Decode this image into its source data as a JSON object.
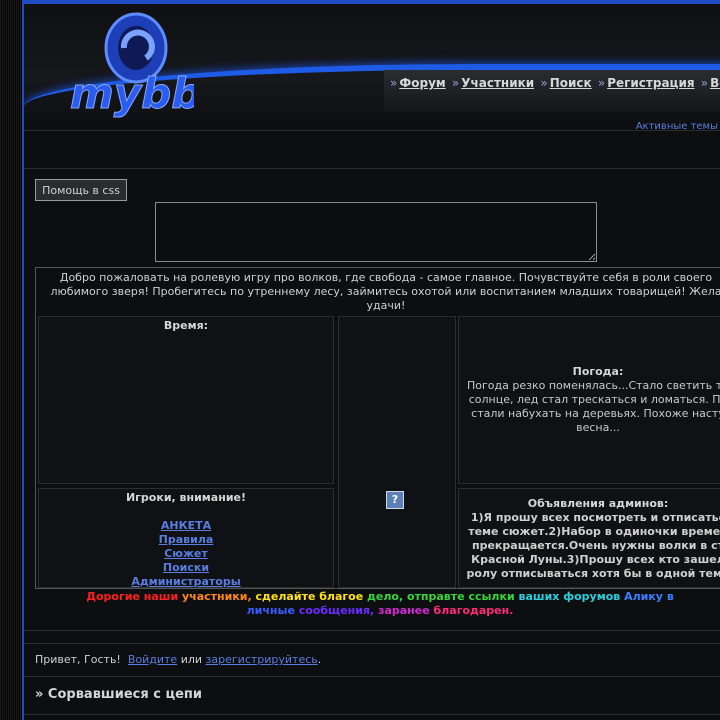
{
  "header": {
    "logo_text": "mybb",
    "nav": [
      {
        "sep": "»",
        "label": "Форум"
      },
      {
        "sep": "»",
        "label": "Участники"
      },
      {
        "sep": "»",
        "label": "Поиск"
      },
      {
        "sep": "»",
        "label": "Регистрация"
      },
      {
        "sep": "»",
        "label": "Войти"
      }
    ],
    "active_topics": "Активные темы"
  },
  "toolbar": {
    "help_button": "Помощь в css",
    "textarea_value": ""
  },
  "welcome": "Добро пожаловать на ролевую игру про волков, где свобода - самое главное. Почувствуйте себя в роли своего\nлюбимого зверя! Пробегитесь по утреннему лесу, займитесь охотой или воспитанием младших товарищей! Жела\nудачи!",
  "time": {
    "title": "Время:"
  },
  "weather": {
    "title": "Погода:",
    "text": "Погода резко поменялась...Стало светить те\nсолнце, лед стал трескаться и ломаться. По\nстали набухать на деревьях. Похоже насту\nвесна..."
  },
  "center_image": {
    "icon": "broken-image-icon",
    "glyph": "?"
  },
  "players": {
    "title": "Игроки, внимание!",
    "links": [
      "АНКЕТА ",
      "Правила ",
      "Сюжет ",
      "Поиски ",
      "Администраторы"
    ]
  },
  "admins": {
    "title": "Объявления админов:",
    "text": "1)Я прошу всех посмотреть и отписатьс\nтеме сюжет.2)Набор в одиночки времен\nпрекращается.Очень нужны волки в ст\nКрасной Луны.3)Прошу всех кто зашел\nролу отписываться хотя бы в одной теме"
  },
  "rainbow_words": [
    {
      "text": "Дорогие ",
      "color": "#ff2020"
    },
    {
      "text": "наши ",
      "color": "#ff2020"
    },
    {
      "text": "участники, ",
      "color": "#ff8a1a"
    },
    {
      "text": "сделайте ",
      "color": "#ffe21a"
    },
    {
      "text": "благое ",
      "color": "#ffe21a"
    },
    {
      "text": "дело, ",
      "color": "#3ad43a"
    },
    {
      "text": "отправте ",
      "color": "#3ad43a"
    },
    {
      "text": "ссылки ",
      "color": "#3ad43a"
    },
    {
      "text": "ваших ",
      "color": "#2ad0e0"
    },
    {
      "text": "форумов ",
      "color": "#2ad0e0"
    },
    {
      "text": "Алику ",
      "color": "#3a7fff"
    },
    {
      "text": "в ",
      "color": "#3a7fff"
    },
    {
      "text": "личные ",
      "color": "#3a5cff"
    },
    {
      "text": "сообщения, ",
      "color": "#6a2aff"
    },
    {
      "text": "заранее ",
      "color": "#d22ad2"
    },
    {
      "text": "благодарен.",
      "color": "#ff2a7a"
    }
  ],
  "greeting": {
    "prefix": "Привет, Гость!",
    "login": "Войдите",
    "or": "или",
    "register": "зарегистрируйтесь",
    "suffix": "."
  },
  "section": {
    "title": "» Сорвавшиеся с цепи"
  },
  "colors": {
    "accent": "#1f4cc4",
    "link": "#5a7ee0"
  }
}
